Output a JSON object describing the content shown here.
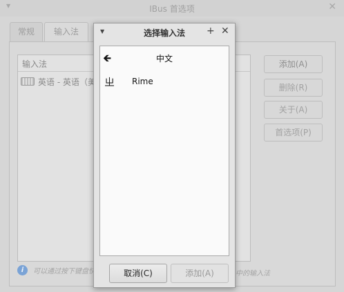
{
  "background_window": {
    "title": "IBus 首选项",
    "tabs": [
      {
        "label": "常规"
      },
      {
        "label": "输入法"
      }
    ],
    "list_header": "输入法",
    "list_items": [
      {
        "label": "英语 - 英语（美",
        "icon": "keyboard-icon"
      }
    ],
    "buttons": {
      "add": "添加(A)",
      "remove": "删除(R)",
      "about": "关于(A)",
      "preferences": "首选项(P)"
    },
    "info_text_left": "可以通过按下键盘快",
    "info_text_right": "中的输入法"
  },
  "dialog": {
    "title": "选择输入法",
    "back_label": "中文",
    "items": [
      {
        "label": "Rime",
        "icon": "rime-icon"
      }
    ],
    "cancel_label": "取消(C)",
    "add_label": "添加(A)"
  },
  "colors": {
    "info_icon": "#7aa3d6",
    "dialog_bg": "#e4e4e4",
    "list_bg": "#fafafa"
  }
}
